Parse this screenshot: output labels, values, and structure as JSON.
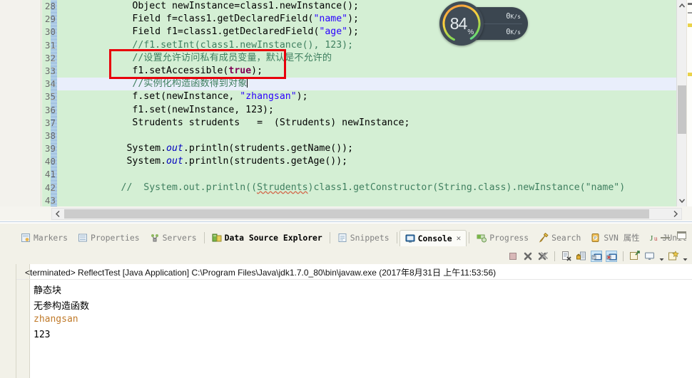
{
  "editor": {
    "first_line": 28,
    "current_line": 34,
    "lines": [
      {
        "n": 28,
        "segs": [
          {
            "t": "          Object newInstance=class1.newInstance();",
            "c": "plain"
          }
        ]
      },
      {
        "n": 29,
        "segs": [
          {
            "t": "          Field f=class1.getDeclaredField(",
            "c": "plain"
          },
          {
            "t": "\"name\"",
            "c": "str"
          },
          {
            "t": ");",
            "c": "plain"
          }
        ]
      },
      {
        "n": 30,
        "segs": [
          {
            "t": "          Field f1=class1.getDeclaredField(",
            "c": "plain"
          },
          {
            "t": "\"age\"",
            "c": "str"
          },
          {
            "t": ");",
            "c": "plain"
          }
        ]
      },
      {
        "n": 31,
        "segs": [
          {
            "t": "          //f1.setInt(class1.newInstance(), 123);",
            "c": "cmt"
          }
        ]
      },
      {
        "n": 32,
        "segs": [
          {
            "t": "          //设置允许访问私有成员变量，默认是不允许的",
            "c": "cmt"
          }
        ]
      },
      {
        "n": 33,
        "segs": [
          {
            "t": "          f1.setAccessible(",
            "c": "plain"
          },
          {
            "t": "true",
            "c": "kw"
          },
          {
            "t": ");",
            "c": "plain"
          }
        ]
      },
      {
        "n": 34,
        "segs": [
          {
            "t": "          //实例化构造函数得到对象",
            "c": "cmt"
          },
          {
            "t": "|caret|",
            "c": "caret"
          }
        ]
      },
      {
        "n": 35,
        "segs": [
          {
            "t": "          f.set(newInstance, ",
            "c": "plain"
          },
          {
            "t": "\"zhangsan\"",
            "c": "str"
          },
          {
            "t": ");",
            "c": "plain"
          }
        ]
      },
      {
        "n": 36,
        "segs": [
          {
            "t": "          f1.set(newInstance, 123);",
            "c": "plain"
          }
        ]
      },
      {
        "n": 37,
        "segs": [
          {
            "t": "          Strudents strudents   =  (Strudents) newInstance;",
            "c": "plain"
          }
        ]
      },
      {
        "n": 38,
        "segs": [
          {
            "t": "",
            "c": "plain"
          }
        ]
      },
      {
        "n": 39,
        "segs": [
          {
            "t": "         System.",
            "c": "plain"
          },
          {
            "t": "out",
            "c": "fld"
          },
          {
            "t": ".println(strudents.getName());",
            "c": "plain"
          }
        ]
      },
      {
        "n": 40,
        "segs": [
          {
            "t": "         System.",
            "c": "plain"
          },
          {
            "t": "out",
            "c": "fld"
          },
          {
            "t": ".println(strudents.getAge());",
            "c": "plain"
          }
        ]
      },
      {
        "n": 41,
        "segs": [
          {
            "t": "",
            "c": "plain"
          }
        ]
      },
      {
        "n": 42,
        "segs": [
          {
            "t": "        //  System.out.println((",
            "c": "cmt"
          },
          {
            "t": "Strudents",
            "c": "cmt-warn"
          },
          {
            "t": ")class1.getConstructor(String.class).newInstance(\"name\")",
            "c": "cmt"
          }
        ]
      },
      {
        "n": 43,
        "segs": [
          {
            "t": "",
            "c": "plain"
          }
        ]
      }
    ],
    "annotation": {
      "shape": "rectangle",
      "color": "#e8000b"
    },
    "scroll_up_icon": "chevron-up-icon",
    "scroll_down_icon": "chevron-down-icon",
    "scroll_left_icon": "chevron-left-icon",
    "scroll_right_icon": "chevron-right-icon"
  },
  "panel": {
    "tabs": [
      {
        "label": "Markers",
        "icon": "markers-icon",
        "active": false,
        "bold": false
      },
      {
        "label": "Properties",
        "icon": "properties-icon",
        "active": false,
        "bold": false
      },
      {
        "label": "Servers",
        "icon": "servers-icon",
        "active": false,
        "bold": false
      },
      {
        "label": "Data Source Explorer",
        "icon": "data-source-explorer-icon",
        "active": false,
        "bold": true
      },
      {
        "label": "Snippets",
        "icon": "snippets-icon",
        "active": false,
        "bold": false
      },
      {
        "label": "Console",
        "icon": "console-icon",
        "active": true,
        "bold": true
      },
      {
        "label": "Progress",
        "icon": "progress-icon",
        "active": false,
        "bold": false
      },
      {
        "label": "Search",
        "icon": "search-icon",
        "active": false,
        "bold": false
      },
      {
        "label": "SVN 属性",
        "icon": "svn-icon",
        "active": false,
        "bold": false
      },
      {
        "label": "JUnit",
        "icon": "junit-icon",
        "active": false,
        "bold": false
      }
    ],
    "close_glyph": "✕",
    "toolbar": [
      {
        "name": "terminate-button",
        "icon": "stop-square-icon",
        "selected": false
      },
      {
        "name": "remove-launch-button",
        "icon": "remove-x-icon",
        "selected": false
      },
      {
        "name": "remove-all-terminated-button",
        "icon": "remove-all-x-icon",
        "selected": false
      },
      {
        "name": "clear-console-button",
        "icon": "clear-console-icon",
        "selected": false
      },
      {
        "name": "scroll-lock-button",
        "icon": "scroll-lock-icon",
        "selected": false
      },
      {
        "name": "show-console-on-output-button",
        "icon": "show-console-stdout-icon",
        "selected": true
      },
      {
        "name": "show-console-on-error-button",
        "icon": "show-console-stderr-icon",
        "selected": true
      },
      {
        "name": "pin-console-button",
        "icon": "pin-console-icon",
        "selected": false
      },
      {
        "name": "display-selected-console-button",
        "icon": "display-console-icon",
        "selected": false
      },
      {
        "name": "open-console-button",
        "icon": "open-console-icon",
        "selected": false
      }
    ],
    "window_buttons": [
      {
        "name": "minimize-panel-button",
        "icon": "minimize-icon"
      },
      {
        "name": "maximize-panel-button",
        "icon": "maximize-icon"
      }
    ]
  },
  "console": {
    "header": "<terminated> ReflectTest [Java Application] C:\\Program Files\\Java\\jdk1.7.0_80\\bin\\javaw.exe (2017年8月31日 上午11:53:56)",
    "output_lines": [
      "静态块",
      "无参构造函数",
      "zhangsan",
      "123"
    ]
  },
  "monitor_widget": {
    "cpu_percent": "84",
    "percent_symbol": "%",
    "upload": {
      "value": "0",
      "unit": "K/s",
      "arrow": "arrow-up-icon",
      "color": "#3ba9e0"
    },
    "download": {
      "value": "0",
      "unit": "K/s",
      "arrow": "arrow-down-icon",
      "color": "#57c25a"
    },
    "ring_colors": [
      "#ff8a3d",
      "#ffd23d",
      "#7ed957",
      "#3ddbc6"
    ]
  }
}
